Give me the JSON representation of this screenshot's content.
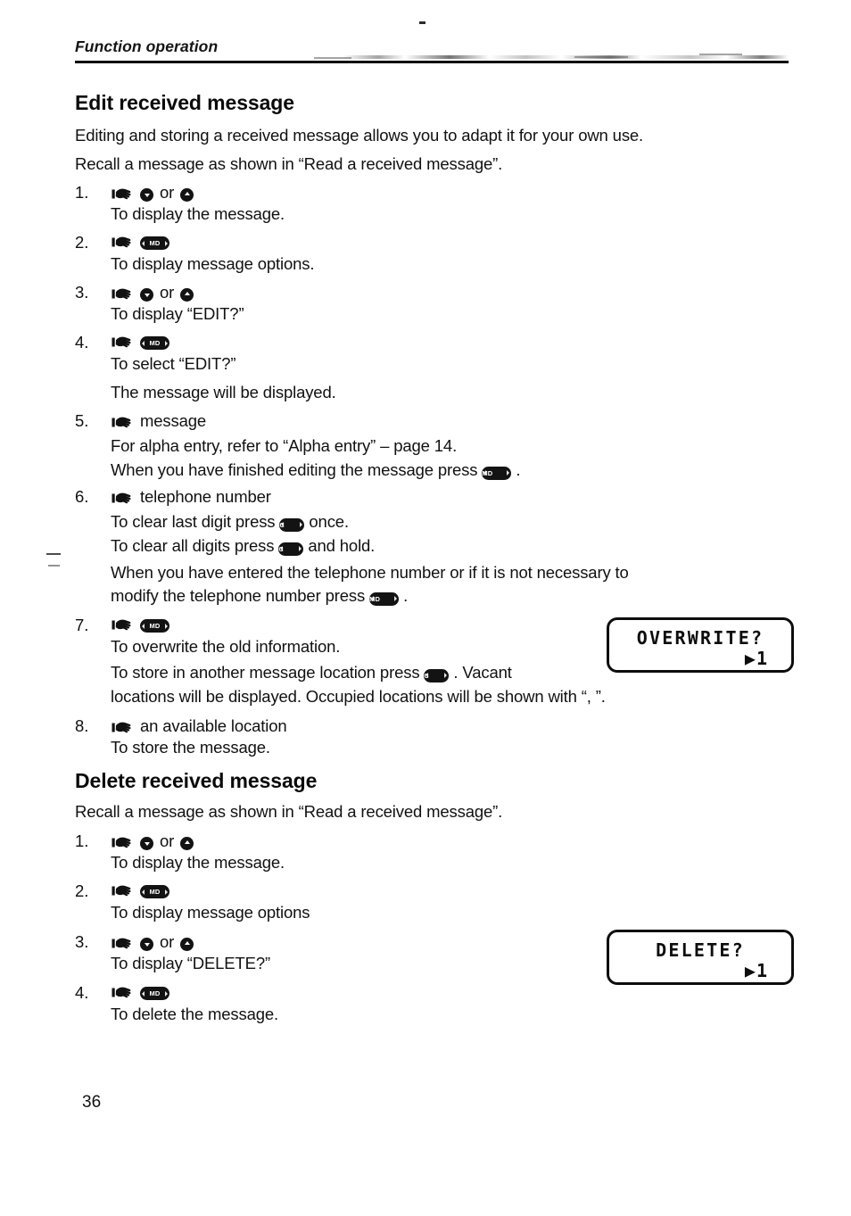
{
  "header": {
    "running_title": "Function operation"
  },
  "page_number": "36",
  "sections": [
    {
      "id": "edit",
      "heading": "Edit received message",
      "intro": [
        "Editing and storing a received message allows you to adapt it for your own use.",
        "Recall a message as shown in “Read a received message”."
      ],
      "steps": [
        {
          "num": "1.",
          "action_icons": "hand down or up",
          "desc": [
            "To display the message."
          ]
        },
        {
          "num": "2.",
          "action_icons": "hand memo",
          "desc": [
            "To display message options."
          ]
        },
        {
          "num": "3.",
          "action_icons": "hand down or up",
          "desc": [
            "To display “EDIT?”"
          ]
        },
        {
          "num": "4.",
          "action_icons": "hand memo",
          "desc": [
            "To select “EDIT?”",
            "The message will be displayed."
          ]
        },
        {
          "num": "5.",
          "action_label": "message",
          "desc": [
            "For alpha entry, refer to “Alpha entry” – page 14.",
            "When you have finished editing the message press"
          ]
        },
        {
          "num": "6.",
          "action_label": "telephone number",
          "desc": [
            "To clear last digit press",
            "To clear all digits press",
            "When you have entered the telephone number or if it is not necessary to",
            "modify the telephone number press"
          ]
        },
        {
          "num": "7.",
          "action_icons": "hand memo",
          "desc": [
            "To overwrite the old information.",
            "To store in another message location press",
            "locations will be displayed. Occupied locations will be shown with “, ”."
          ]
        },
        {
          "num": "8.",
          "action_label": "an available location",
          "desc": [
            "To store the message."
          ]
        }
      ]
    },
    {
      "id": "delete",
      "heading": "Delete received message",
      "intro": [
        "Recall a message as shown in “Read a received message”."
      ],
      "steps": [
        {
          "num": "1.",
          "action_icons": "hand down or up",
          "desc": [
            "To display the message."
          ]
        },
        {
          "num": "2.",
          "action_icons": "hand memo",
          "desc": [
            "To display message options"
          ]
        },
        {
          "num": "3.",
          "action_icons": "hand down or up",
          "desc": [
            "To display “DELETE?”"
          ]
        },
        {
          "num": "4.",
          "action_icons": "hand memo",
          "desc": [
            "To delete the message."
          ]
        }
      ]
    }
  ],
  "text": {
    "edit_intro_1": "Editing and storing a received message allows you to adapt it for your own use.",
    "edit_intro_2": "Recall a message as shown in “Read a received message”.",
    "s1_desc": "To display the message.",
    "s2_desc": "To display message options.",
    "s3_desc": "To display “EDIT?”",
    "s4_desc": "To select “EDIT?”",
    "s4_desc2": "The message will be displayed.",
    "s5_label": "message",
    "s5_desc1": "For alpha entry, refer to “Alpha entry” – page 14.",
    "s5_desc2_a": "When you have finished editing the message press",
    "s5_desc2_b": ".",
    "s6_label": "telephone number",
    "s6_desc1_a": "To clear last digit press",
    "s6_desc1_b": "once.",
    "s6_desc2_a": "To clear all digits press",
    "s6_desc2_b": "and hold.",
    "s6_desc3": "When you have entered the telephone number or if it is not necessary to",
    "s6_desc4_a": "modify the telephone number press",
    "s6_desc4_b": ".",
    "s7_desc1": "To overwrite the old information.",
    "s7_desc2_a": "To store in another message location press",
    "s7_desc2_b": ". Vacant",
    "s7_desc3": "locations will be displayed. Occupied locations will be shown with “, ”.",
    "s8_label": "an available location",
    "s8_desc": "To store the message.",
    "del_intro_1": "Recall a message as shown in “Read a received message”.",
    "d1_desc": "To display the message.",
    "d2_desc": "To display message options",
    "d3_desc": "To display “DELETE?”",
    "d4_desc": "To delete the message.",
    "or": "or"
  },
  "buttons": {
    "memo_label": "MD",
    "clear_label": "C",
    "store_label": "MD"
  },
  "displays": [
    {
      "id": "overwrite",
      "line1": "OVERWRITE?",
      "line2": "▶1"
    },
    {
      "id": "delete",
      "line1": "DELETE?",
      "line2": "▶1"
    }
  ],
  "display_overwrite": {
    "line1": "OVERWRITE?",
    "line2": "▶1"
  },
  "display_delete": {
    "line1": "DELETE?",
    "line2": "▶1"
  },
  "colors": {
    "ink": "#0a0a0a",
    "paper": "#ffffff"
  }
}
